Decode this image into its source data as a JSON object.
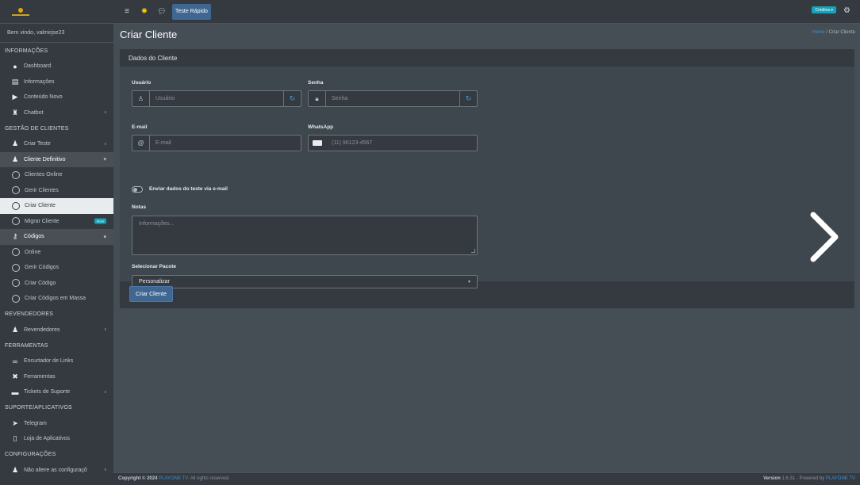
{
  "sidebar": {
    "welcome": "Bem vindo, valmirjse23",
    "sections": {
      "informacoes": "INFORMAÇÕES",
      "gestao": "GESTÃO DE CLIENTES",
      "revendedores": "REVENDEDORES",
      "ferramentas": "FERRAMENTAS",
      "suporte": "SUPORTE/APLICATIVOS",
      "configuracoes": "CONFIGURAÇÕES"
    },
    "items": {
      "dashboard": "Dashboard",
      "informacoes": "Informações",
      "conteudo_novo": "Conteúdo Novo",
      "chatbot": "Chatbot",
      "criar_teste": "Criar Teste",
      "cliente_definitivo": "Cliente Definitivo",
      "clientes_online": "Clientes Online",
      "gerir_clientes": "Gerir Clientes",
      "criar_cliente": "Criar Cliente",
      "migrar_cliente": "Migrar Cliente",
      "migrar_badge": "Novo",
      "codigos": "Códigos",
      "online": "Online",
      "gerir_codigos": "Gerir Códigos",
      "criar_codigo": "Criar Código",
      "criar_codigos_massa": "Criar Códigos em Massa",
      "revendedores": "Revendedores",
      "encurtador": "Encurtador de Links",
      "ferramentas": "Ferramentas",
      "tickets": "Tickets de Suporte",
      "telegram": "Telegram",
      "loja": "Loja de Aplicativos",
      "nao_altere": "Não altere as configuraçõ"
    }
  },
  "topbar": {
    "teste_rapido": "Teste Rápido",
    "creditos": "Créditos ▾"
  },
  "page": {
    "title": "Criar Cliente",
    "breadcrumb_home": "Home",
    "breadcrumb_sep": " / ",
    "breadcrumb_current": "Criar Cliente"
  },
  "form": {
    "card_title": "Dados do Cliente",
    "usuario_label": "Usuário",
    "usuario_placeholder": "Usuário",
    "senha_label": "Senha",
    "senha_placeholder": "Senha",
    "email_label": "E-mail",
    "email_placeholder": "E-mail",
    "whatsapp_label": "WhatsApp",
    "whatsapp_placeholder": "(11) 96123-4567",
    "toggle_label": "Enviar dados do teste via e-mail",
    "notas_label": "Notas",
    "notas_placeholder": "Informações...",
    "pacote_label": "Selecionar Pacote",
    "pacote_value": "Personalizar",
    "submit": "Criar Cliente"
  },
  "footer": {
    "copyright_prefix": "Copyright © 2024 ",
    "brand": "PLAYONE TV",
    "rights": ". All rights reserved.",
    "version_label": "Version",
    "version": " 1.6.31",
    "powered": " - Powered by ",
    "powered_brand": "PLAYONE TV"
  }
}
